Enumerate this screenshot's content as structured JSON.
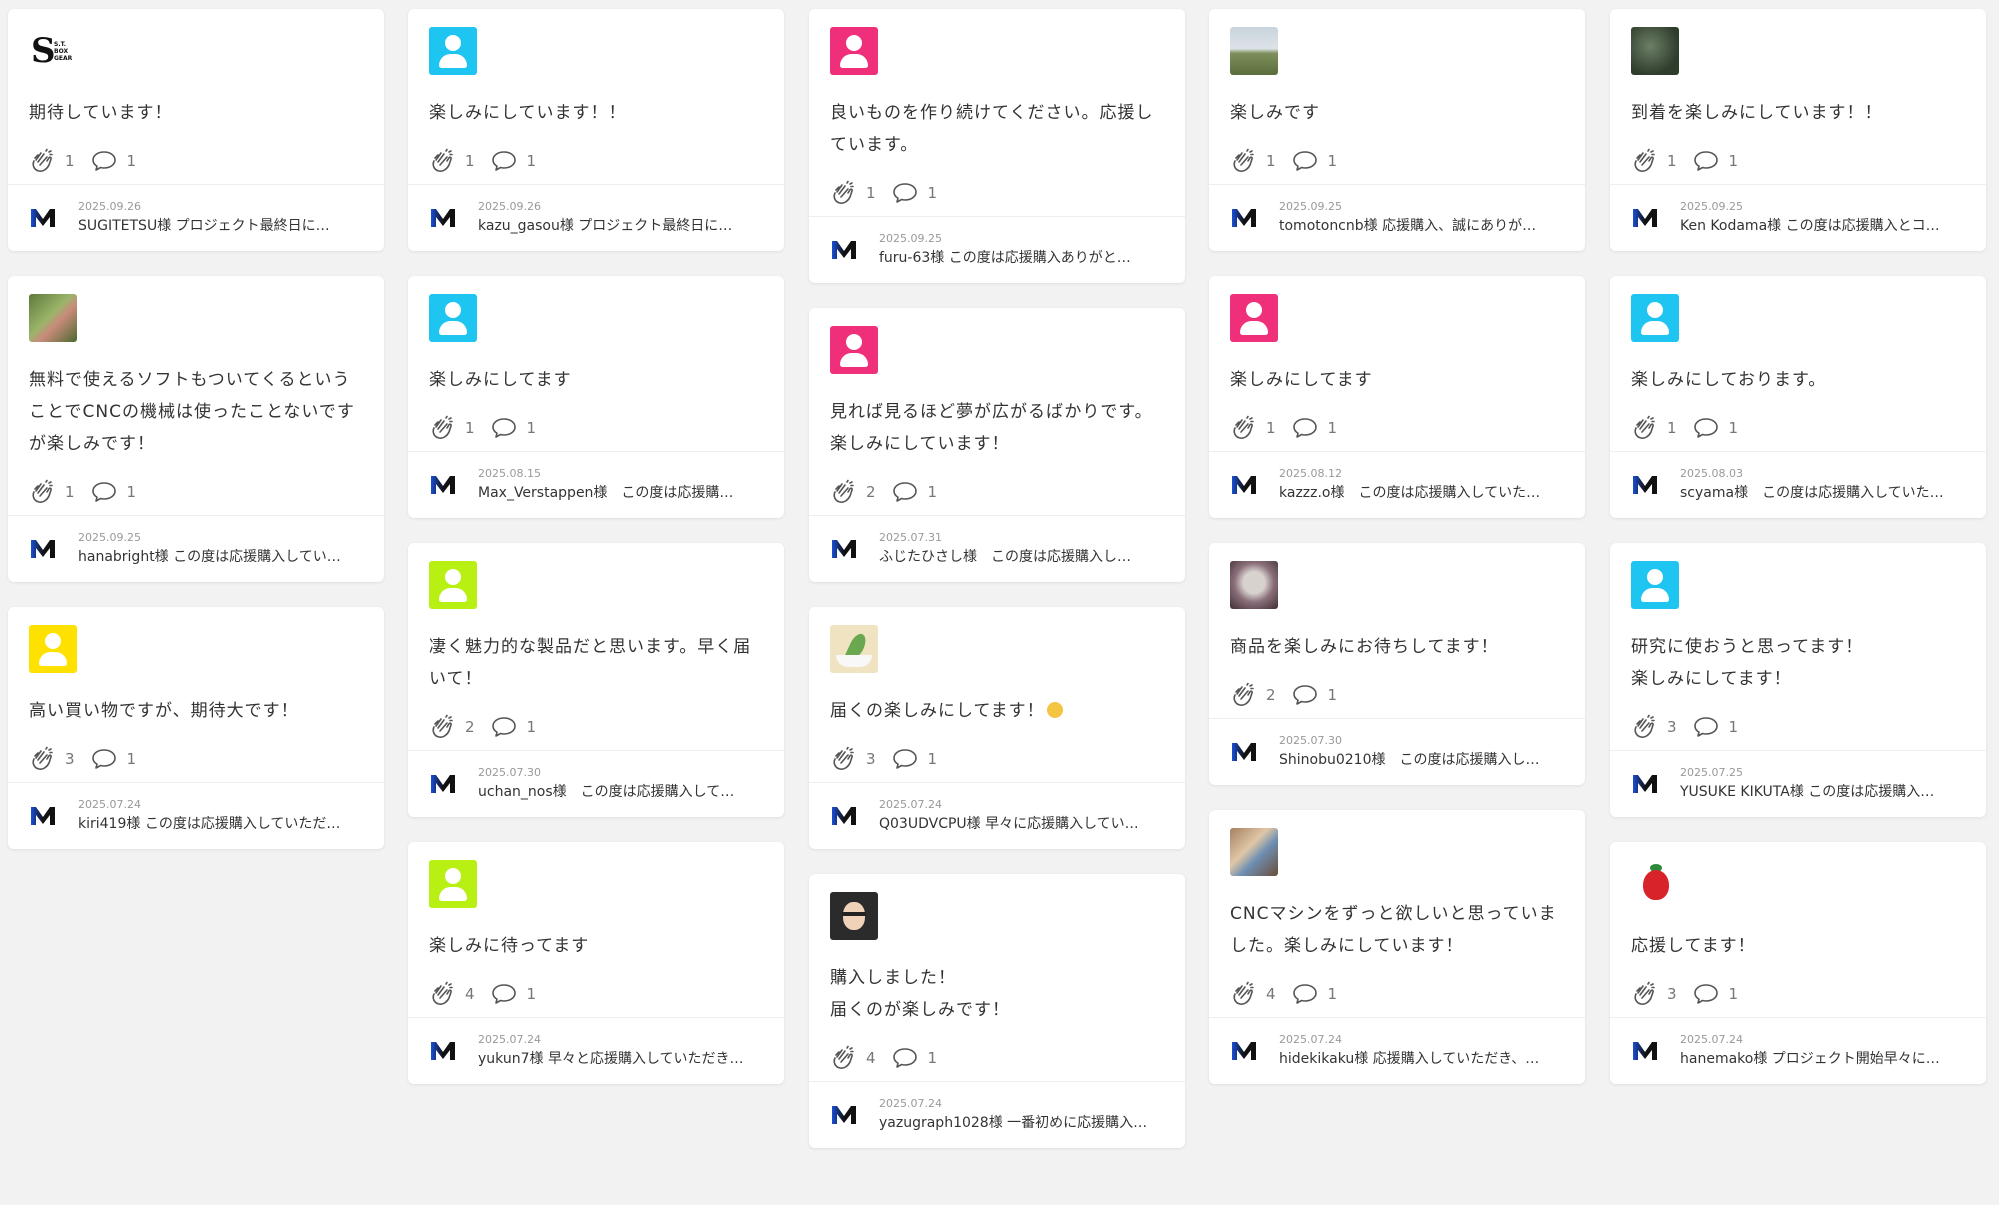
{
  "columns": [
    [
      {
        "avatar": {
          "type": "logo",
          "logo_text": "S.T. BOX GEAR"
        },
        "text": "期待しています！",
        "claps": "1",
        "comments": "1",
        "reply_date": "2025.09.26",
        "reply": "SUGITETSU様 プロジェクト最終日に…"
      },
      {
        "avatar": {
          "type": "photo-green"
        },
        "text": "無料で使えるソフトもついてくるということでCNCの機械は使ったことないですが楽しみです！",
        "claps": "1",
        "comments": "1",
        "reply_date": "2025.09.25",
        "reply": "hanabright様 この度は応援購入してい…"
      },
      {
        "avatar": {
          "type": "default",
          "color": "#ffe100"
        },
        "text": "高い買い物ですが、期待大です！",
        "claps": "3",
        "comments": "1",
        "reply_date": "2025.07.24",
        "reply": "kiri419様 この度は応援購入していただ…"
      }
    ],
    [
      {
        "avatar": {
          "type": "default",
          "color": "#1ec5f0"
        },
        "text": "楽しみにしています！！",
        "claps": "1",
        "comments": "1",
        "reply_date": "2025.09.26",
        "reply": "kazu_gasou様 プロジェクト最終日に…"
      },
      {
        "avatar": {
          "type": "default",
          "color": "#1ec5f0"
        },
        "text": "楽しみにしてます",
        "claps": "1",
        "comments": "1",
        "reply_date": "2025.08.15",
        "reply": "Max_Verstappen様　この度は応援購…"
      },
      {
        "avatar": {
          "type": "default",
          "color": "#b8f014"
        },
        "text": "凄く魅力的な製品だと思います。早く届いて！",
        "claps": "2",
        "comments": "1",
        "reply_date": "2025.07.30",
        "reply": "uchan_nos様　この度は応援購入して…"
      },
      {
        "avatar": {
          "type": "default",
          "color": "#b8f014"
        },
        "text": "楽しみに待ってます",
        "claps": "4",
        "comments": "1",
        "reply_date": "2025.07.24",
        "reply": "yukun7様 早々と応援購入していただき…"
      }
    ],
    [
      {
        "avatar": {
          "type": "default",
          "color": "#f02f7a"
        },
        "text": "良いものを作り続けてください。応援しています。",
        "claps": "1",
        "comments": "1",
        "reply_date": "2025.09.25",
        "reply": "furu-63様 この度は応援購入ありがと…"
      },
      {
        "avatar": {
          "type": "default",
          "color": "#f02f7a"
        },
        "text": "見れば見るほど夢が広がるばかりです。\n楽しみにしています！",
        "claps": "2",
        "comments": "1",
        "reply_date": "2025.07.31",
        "reply": "ふじたひさし様　この度は応援購入し…"
      },
      {
        "avatar": {
          "type": "illust-leaf"
        },
        "text": "届くの楽しみにしてます！",
        "emoji": true,
        "claps": "3",
        "comments": "1",
        "reply_date": "2025.07.24",
        "reply": "Q03UDVCPU様 早々に応援購入してい…"
      },
      {
        "avatar": {
          "type": "illust-face"
        },
        "text": "購入しました！\n届くのが楽しみです！",
        "claps": "4",
        "comments": "1",
        "reply_date": "2025.07.24",
        "reply": "yazugraph1028様 一番初めに応援購入…"
      }
    ],
    [
      {
        "avatar": {
          "type": "photo-field"
        },
        "text": "楽しみです",
        "claps": "1",
        "comments": "1",
        "reply_date": "2025.09.25",
        "reply": "tomotoncnb様 応援購入、誠にありが…"
      },
      {
        "avatar": {
          "type": "default",
          "color": "#f02f7a"
        },
        "text": "楽しみにしてます",
        "claps": "1",
        "comments": "1",
        "reply_date": "2025.08.12",
        "reply": "kazzz.o様　この度は応援購入していた…"
      },
      {
        "avatar": {
          "type": "photo-cat"
        },
        "text": "商品を楽しみにお待ちしてます！",
        "claps": "2",
        "comments": "1",
        "reply_date": "2025.07.30",
        "reply": "Shinobu0210様　この度は応援購入し…"
      },
      {
        "avatar": {
          "type": "photo-people"
        },
        "text": "CNCマシンをずっと欲しいと思っていました。楽しみにしています！",
        "claps": "4",
        "comments": "1",
        "reply_date": "2025.07.24",
        "reply": "hidekikaku様 応援購入していただき、…"
      }
    ],
    [
      {
        "avatar": {
          "type": "photo-tree"
        },
        "text": "到着を楽しみにしています！！",
        "claps": "1",
        "comments": "1",
        "reply_date": "2025.09.25",
        "reply": "Ken Kodama様 この度は応援購入とコ…"
      },
      {
        "avatar": {
          "type": "default",
          "color": "#1ec5f0"
        },
        "text": "楽しみにしております。",
        "claps": "1",
        "comments": "1",
        "reply_date": "2025.08.03",
        "reply": "scyama様　この度は応援購入していた…"
      },
      {
        "avatar": {
          "type": "default",
          "color": "#1ec5f0"
        },
        "text": "研究に使おうと思ってます！\n楽しみにしてます！",
        "claps": "3",
        "comments": "1",
        "reply_date": "2025.07.25",
        "reply": "YUSUKE KIKUTA様 この度は応援購入…"
      },
      {
        "avatar": {
          "type": "tomato"
        },
        "text": "応援してます！",
        "claps": "3",
        "comments": "1",
        "reply_date": "2025.07.24",
        "reply": "hanemako様 プロジェクト開始早々に…"
      }
    ]
  ],
  "icons": {
    "clap": "clap-icon",
    "comment": "comment-bubble-icon",
    "reply_logo": "m-logo-icon"
  },
  "colors": {
    "cyan": "#1ec5f0",
    "pink": "#f02f7a",
    "lime": "#b8f014",
    "yellow": "#ffe100"
  }
}
